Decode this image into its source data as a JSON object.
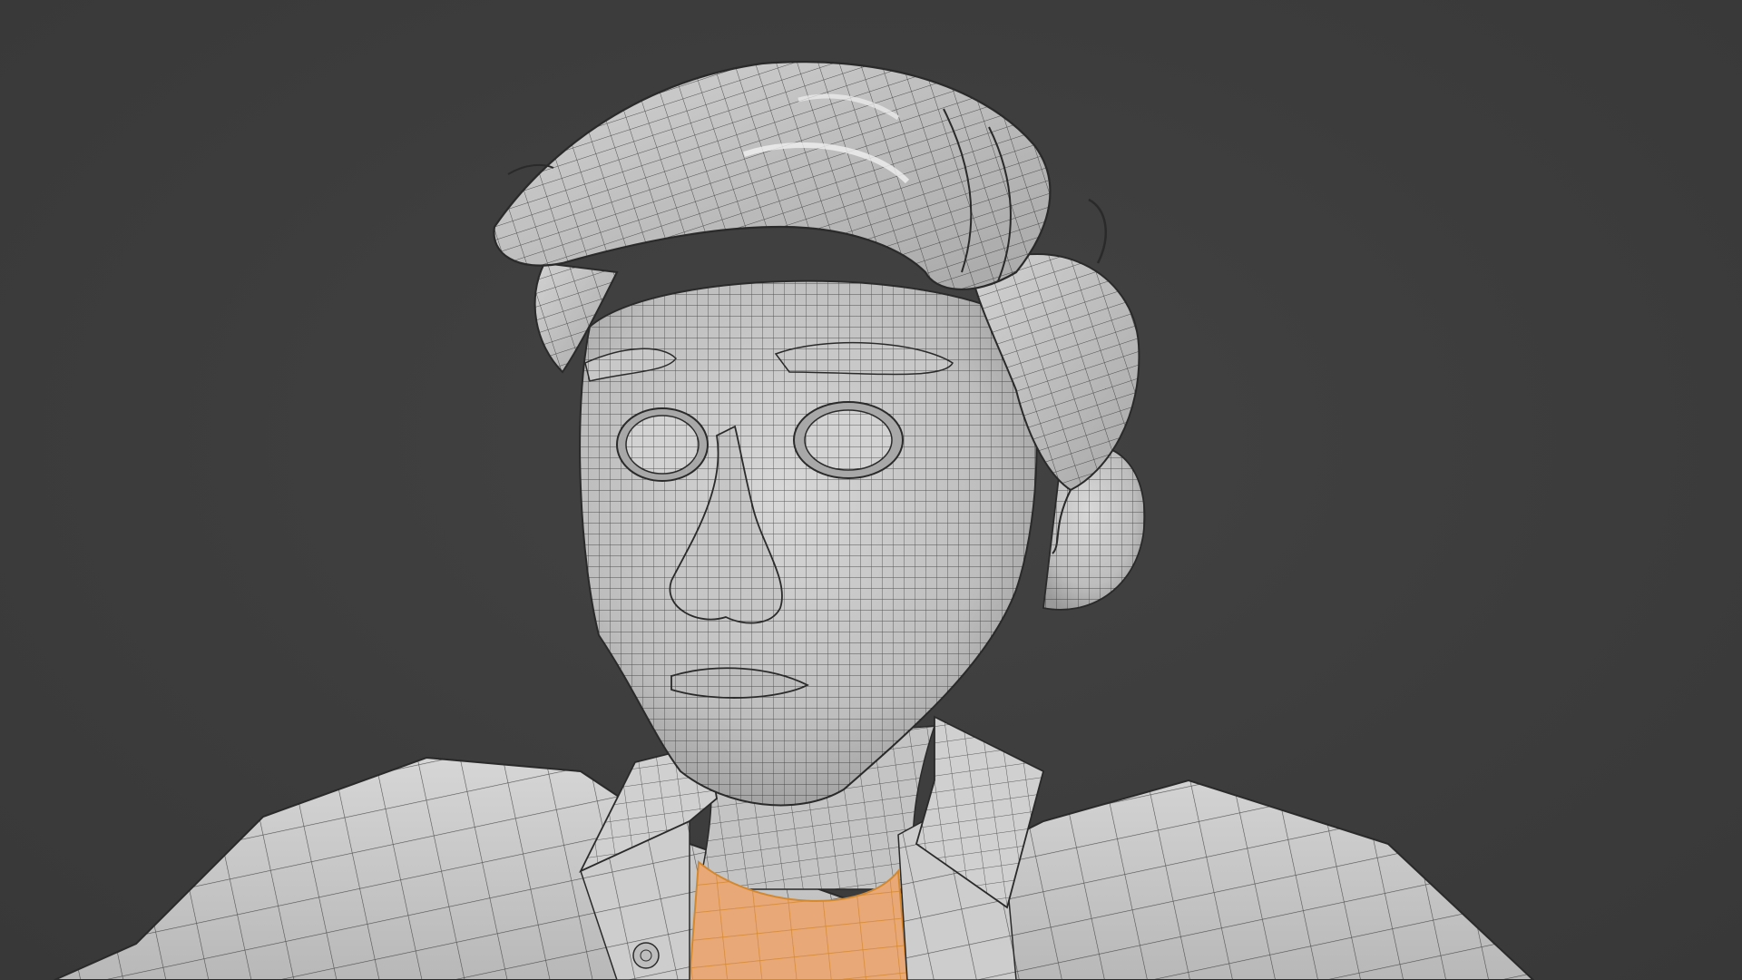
{
  "viewport": {
    "mode": "solid-shading-wireframe-overlay",
    "subject": "character-bust",
    "background_color": "#3d3d3d",
    "mesh_color": "#cfcfcf",
    "wire_color": "#2b2b2b",
    "selection_color": "#e8a878",
    "selection_wire_color": "#d4882e"
  }
}
